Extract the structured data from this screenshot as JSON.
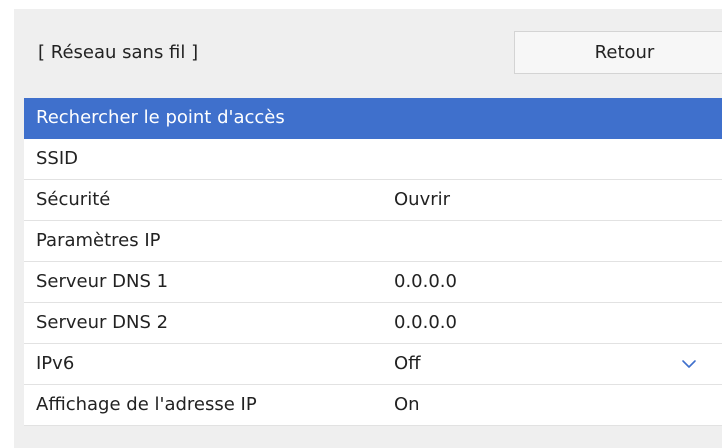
{
  "header": {
    "title": "[ Réseau sans fil ]",
    "back_label": "Retour"
  },
  "menu": {
    "items": [
      {
        "label": "Rechercher le point d'accès",
        "value": "",
        "selected": true
      },
      {
        "label": "SSID",
        "value": ""
      },
      {
        "label": "Sécurité",
        "value": "Ouvrir"
      },
      {
        "label": "Paramètres IP",
        "value": ""
      },
      {
        "label": "Serveur DNS 1",
        "value": "0.0.0.0"
      },
      {
        "label": "Serveur DNS 2",
        "value": "0.0.0.0"
      },
      {
        "label": "IPv6",
        "value": "Off",
        "icon": "chevron-down-icon"
      },
      {
        "label": "Affichage de l'adresse IP",
        "value": "On"
      }
    ]
  },
  "colors": {
    "selection": "#3f70cc",
    "panel_background": "#efefef",
    "chevron": "#3f70cc"
  }
}
